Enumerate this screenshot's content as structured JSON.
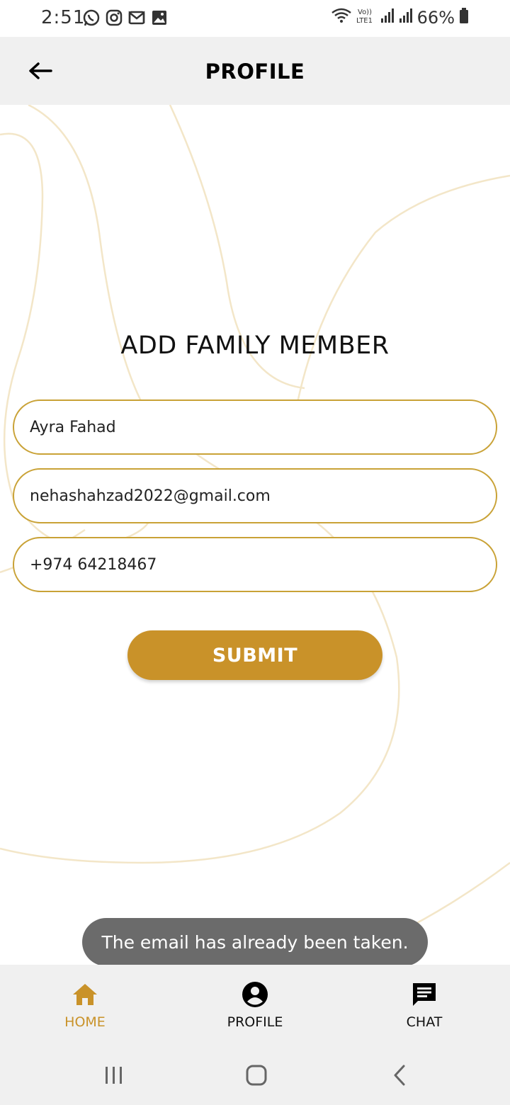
{
  "status_bar": {
    "time": "2:51",
    "battery": "66%",
    "network_label": "Vo)) LTE1"
  },
  "header": {
    "title": "PROFILE"
  },
  "form": {
    "title": "ADD FAMILY MEMBER",
    "name_value": "Ayra Fahad",
    "email_value": "nehashahzad2022@gmail.com",
    "phone_value": "+974 64218467",
    "submit_label": "SUBMIT"
  },
  "toast": {
    "message": "The email has already been taken."
  },
  "bottom_nav": {
    "items": [
      {
        "label": "HOME",
        "icon": "home-icon",
        "active": true
      },
      {
        "label": "PROFILE",
        "icon": "account-circle-icon",
        "active": false
      },
      {
        "label": "CHAT",
        "icon": "chat-icon",
        "active": false
      }
    ]
  },
  "colors": {
    "accent": "#c99229",
    "field_border": "#c9a236",
    "header_bg": "#f0f0f0",
    "toast_bg": "#6b6b6b",
    "decor_line": "#f3e6c8"
  }
}
